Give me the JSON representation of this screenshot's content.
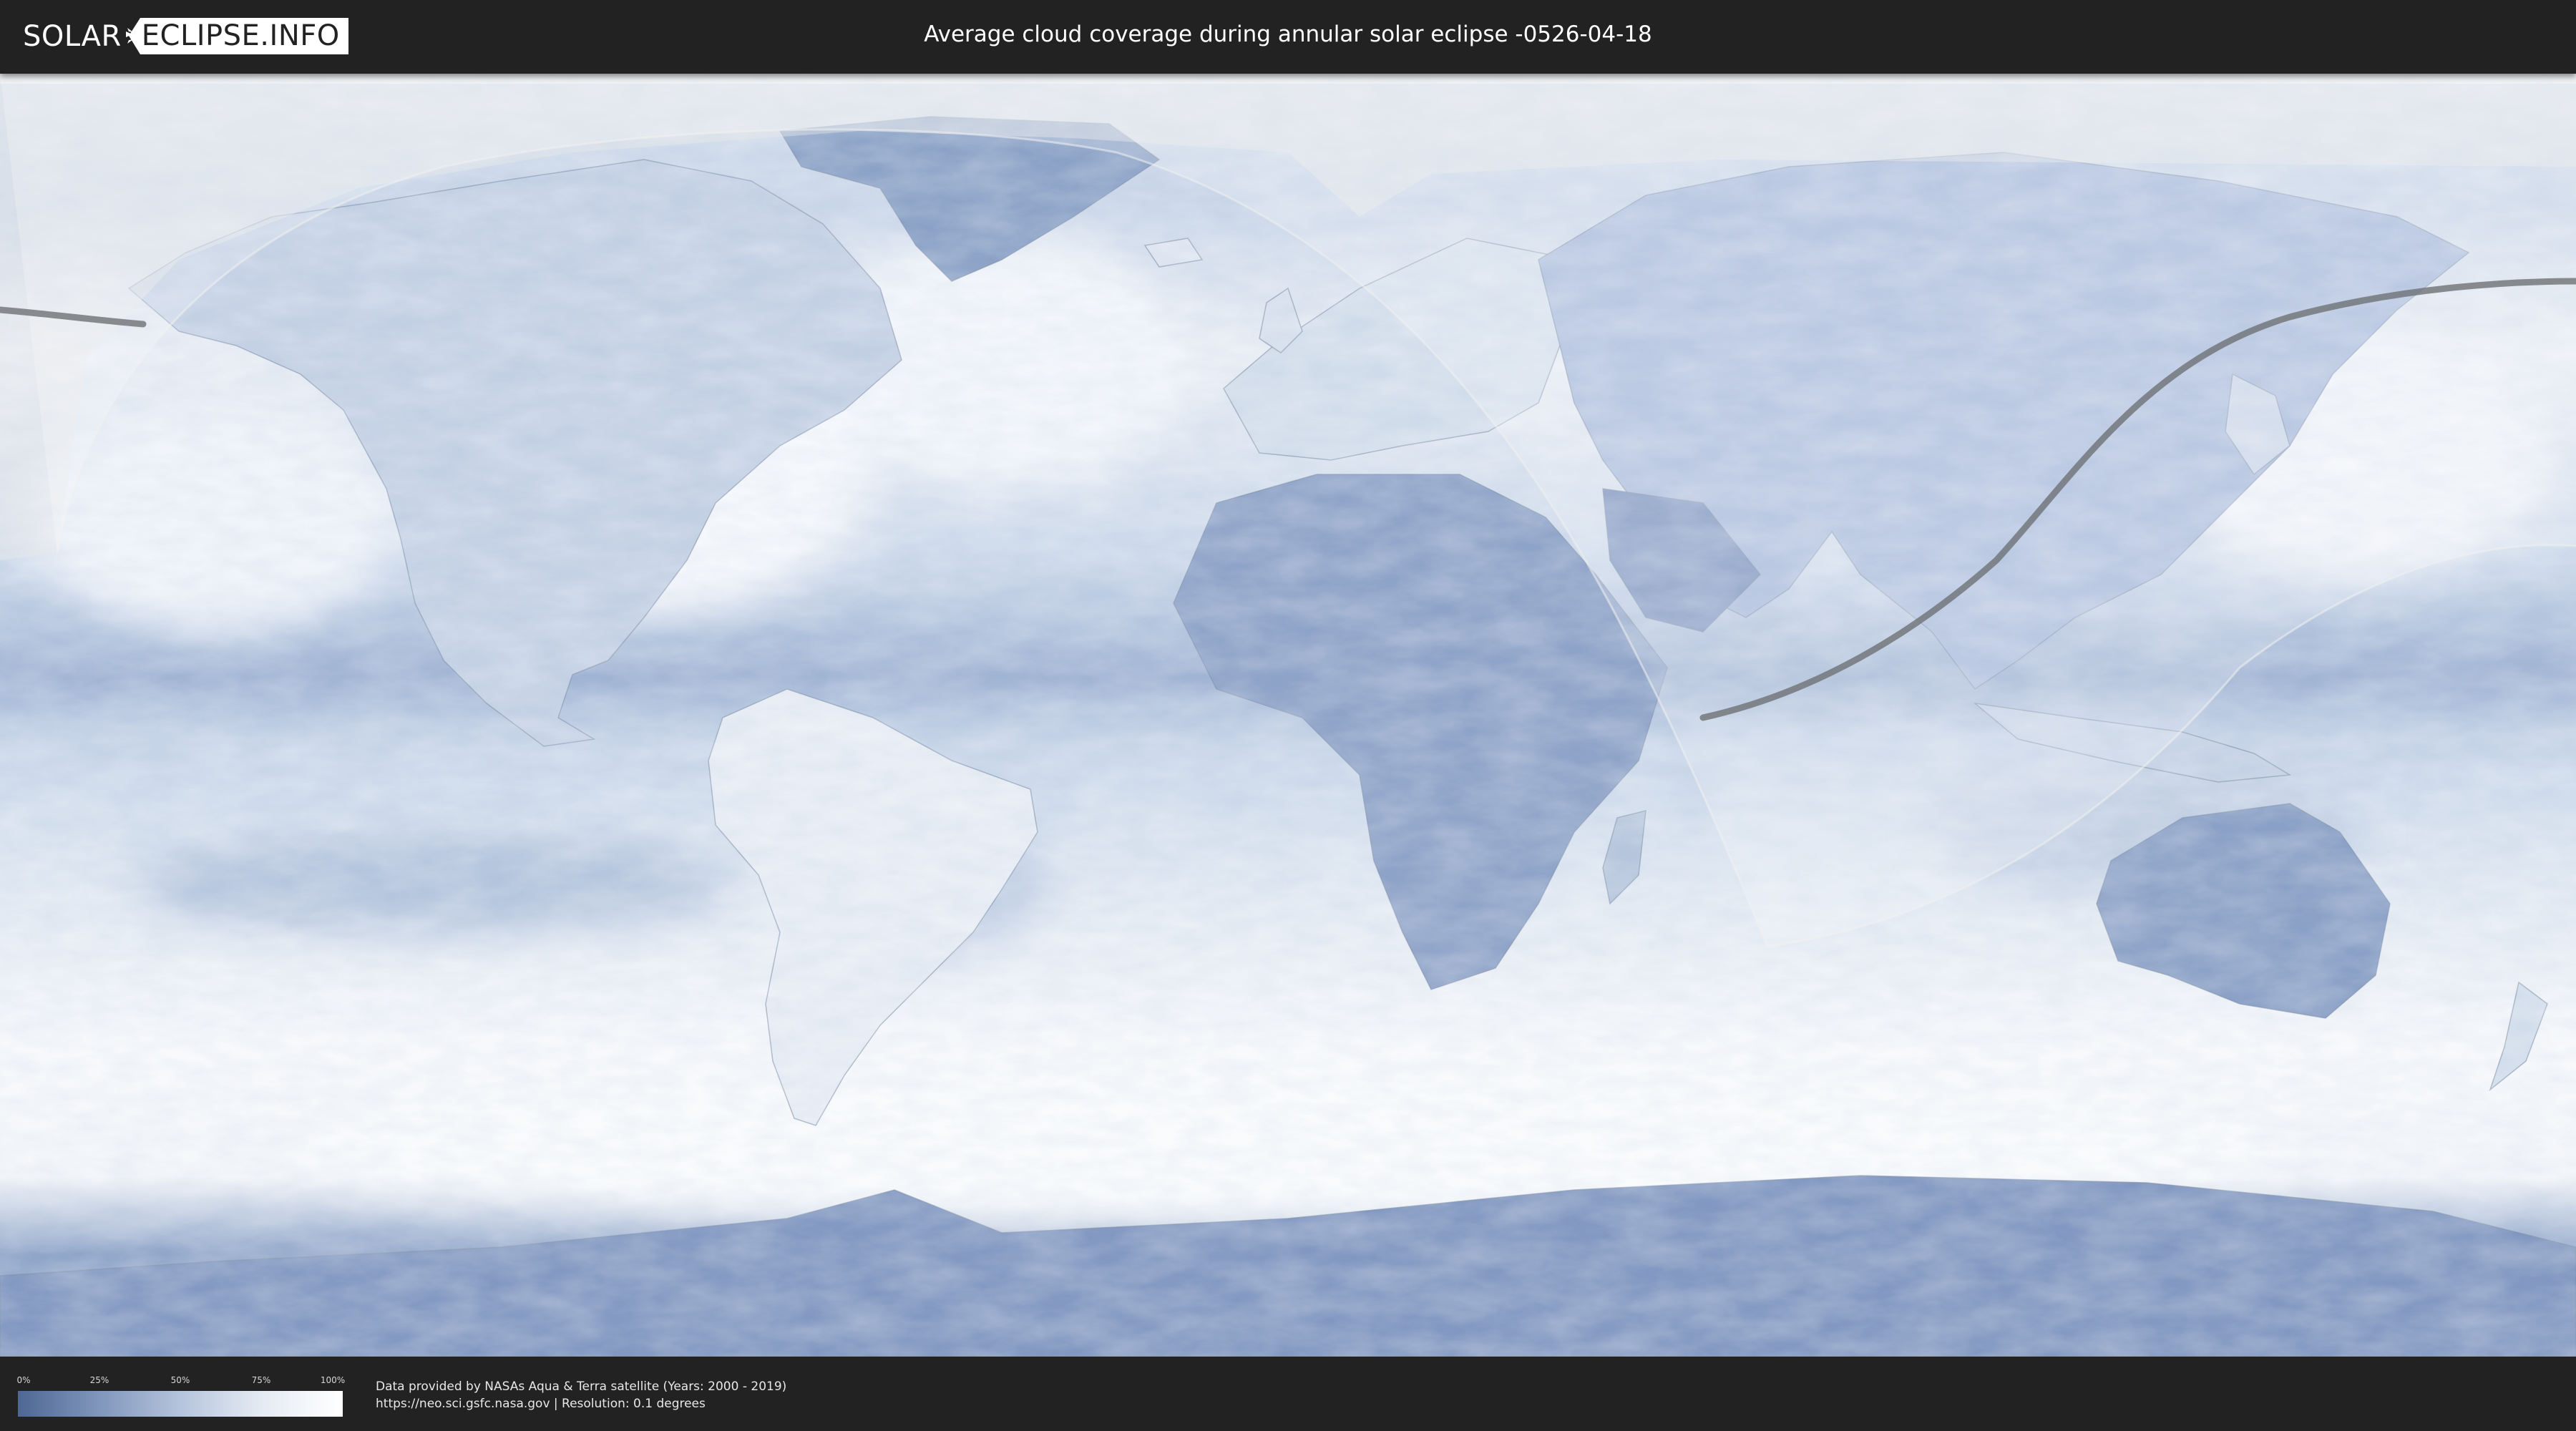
{
  "header": {
    "logo_left": "SOLAR",
    "logo_right": "ECLIPSE.INFO",
    "title": "Average cloud coverage during annular solar eclipse -0526-04-18"
  },
  "map": {
    "projection": "equirectangular",
    "layer": "average cloud coverage",
    "eclipse_type": "annular",
    "eclipse_date": "-0526-04-18",
    "eclipse_path_color": "#6e7276",
    "visibility_region_color": "#e8e8e8",
    "clear_sky_color": "#4e6793",
    "cloudy_color": "#ffffff"
  },
  "legend": {
    "ticks": [
      "0%",
      "25%",
      "50%",
      "75%",
      "100%"
    ],
    "gradient_start": "#4e6793",
    "gradient_end": "#ffffff"
  },
  "credits": {
    "line1": "Data provided by NASAs Aqua & Terra satellite (Years: 2000 - 2019)",
    "line2": "https://neo.sci.gsfc.nasa.gov | Resolution: 0.1 degrees"
  }
}
